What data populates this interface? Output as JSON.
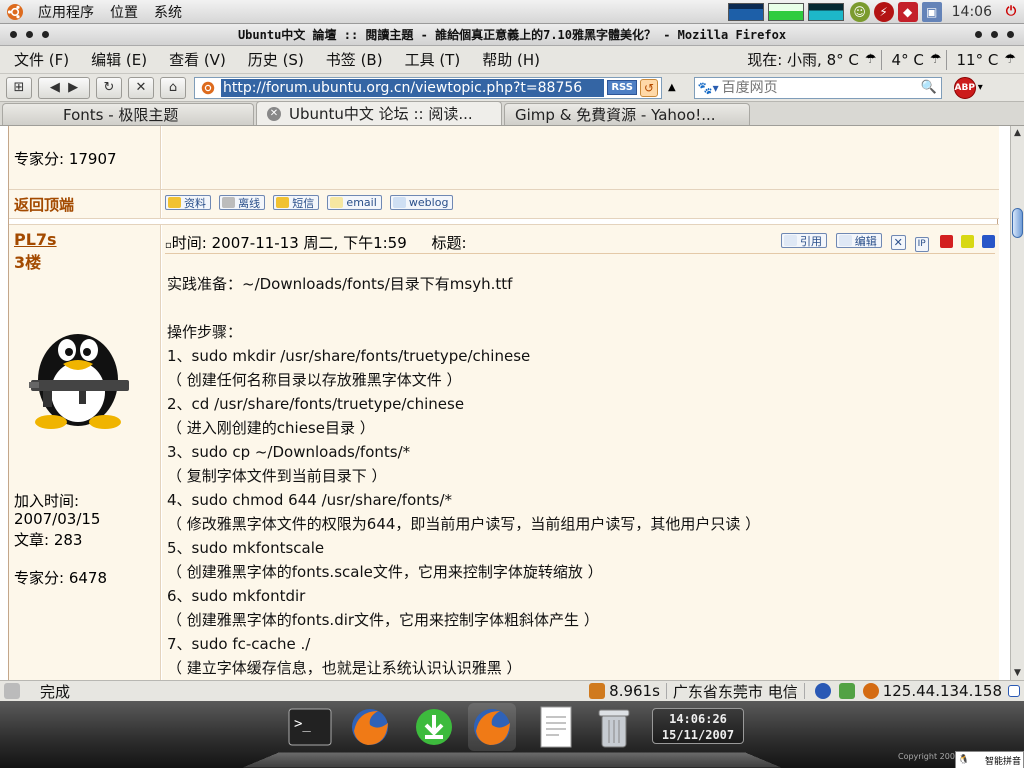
{
  "gnome_panel": {
    "menus": [
      "应用程序",
      "位置",
      "系统"
    ],
    "clock": "14:06"
  },
  "window": {
    "title": "Ubuntu中文 論壇 :: 閱讀主題 - 誰給個真正意義上的7.10雅黑字體美化？ - Mozilla Firefox"
  },
  "menubar": {
    "items": [
      "文件 (F)",
      "编辑 (E)",
      "查看 (V)",
      "历史 (S)",
      "书签 (B)",
      "工具 (T)",
      "帮助 (H)"
    ],
    "weather_now": "现在: 小雨, 8° C",
    "weather_low": "4° C",
    "weather_high": "11° C"
  },
  "navbar": {
    "url": "http://forum.ubuntu.org.cn/viewtopic.php?t=88756",
    "rss_label": "RSS",
    "search_placeholder": "百度网页",
    "abp_label": "ABP"
  },
  "tabs": [
    {
      "label": "Fonts - 极限主题",
      "active": false
    },
    {
      "label": "Ubuntu中文 论坛 :: 阅读...",
      "active": true
    },
    {
      "label": "Gimp & 免費資源 - Yahoo!...",
      "active": false
    }
  ],
  "prev_post": {
    "expert_points": "专家分: 17907",
    "back_to_top": "返回顶端",
    "buttons": [
      "资料",
      "离线",
      "短信",
      "email",
      "weblog"
    ]
  },
  "post": {
    "author": "PL7s",
    "floor": "3楼",
    "time_label": "时间: 2007-11-13 周二, 下午1:59",
    "subject_label": "标题:",
    "action_buttons": [
      "引用",
      "编辑"
    ],
    "join_label": "加入时间:",
    "join_date": "2007/03/15",
    "articles": "文章: 283",
    "expert_points": "专家分: 6478",
    "lines": [
      "实践准备：~/Downloads/fonts/目录下有msyh.ttf",
      "",
      "操作步骤：",
      "1、sudo mkdir /usr/share/fonts/truetype/chinese",
      "（ 创建任何名称目录以存放雅黑字体文件 ）",
      "2、cd /usr/share/fonts/truetype/chinese",
      "（ 进入刚创建的chiese目录 ）",
      "3、sudo cp ~/Downloads/fonts/*",
      "（ 复制字体文件到当前目录下 ）",
      "4、sudo chmod 644 /usr/share/fonts/*",
      "（ 修改雅黑字体文件的权限为644，即当前用户读写，当前组用户读写，其他用户只读 ）",
      "5、sudo mkfontscale",
      "（ 创建雅黑字体的fonts.scale文件，它用来控制字体旋转缩放 ）",
      "6、sudo mkfontdir",
      "（ 创建雅黑字体的fonts.dir文件，它用来控制字体粗斜体产生 ）",
      "7、sudo fc-cache ./",
      "（ 建立字体缓存信息，也就是让系统认识认识雅黑 ）"
    ]
  },
  "statusbar": {
    "status": "完成",
    "load_time": "8.961s",
    "location": "广东省东莞市 电信",
    "ip": "125.44.134.158"
  },
  "dock": {
    "clock_time": "14:06:26",
    "clock_date": "15/11/2007",
    "copyright": "Copyright 2007",
    "ime_label": "智能拼音"
  },
  "colors": {
    "forum_bg": "#fdf7ea",
    "author_color": "#a34a00",
    "selection_blue": "#3465a4"
  }
}
